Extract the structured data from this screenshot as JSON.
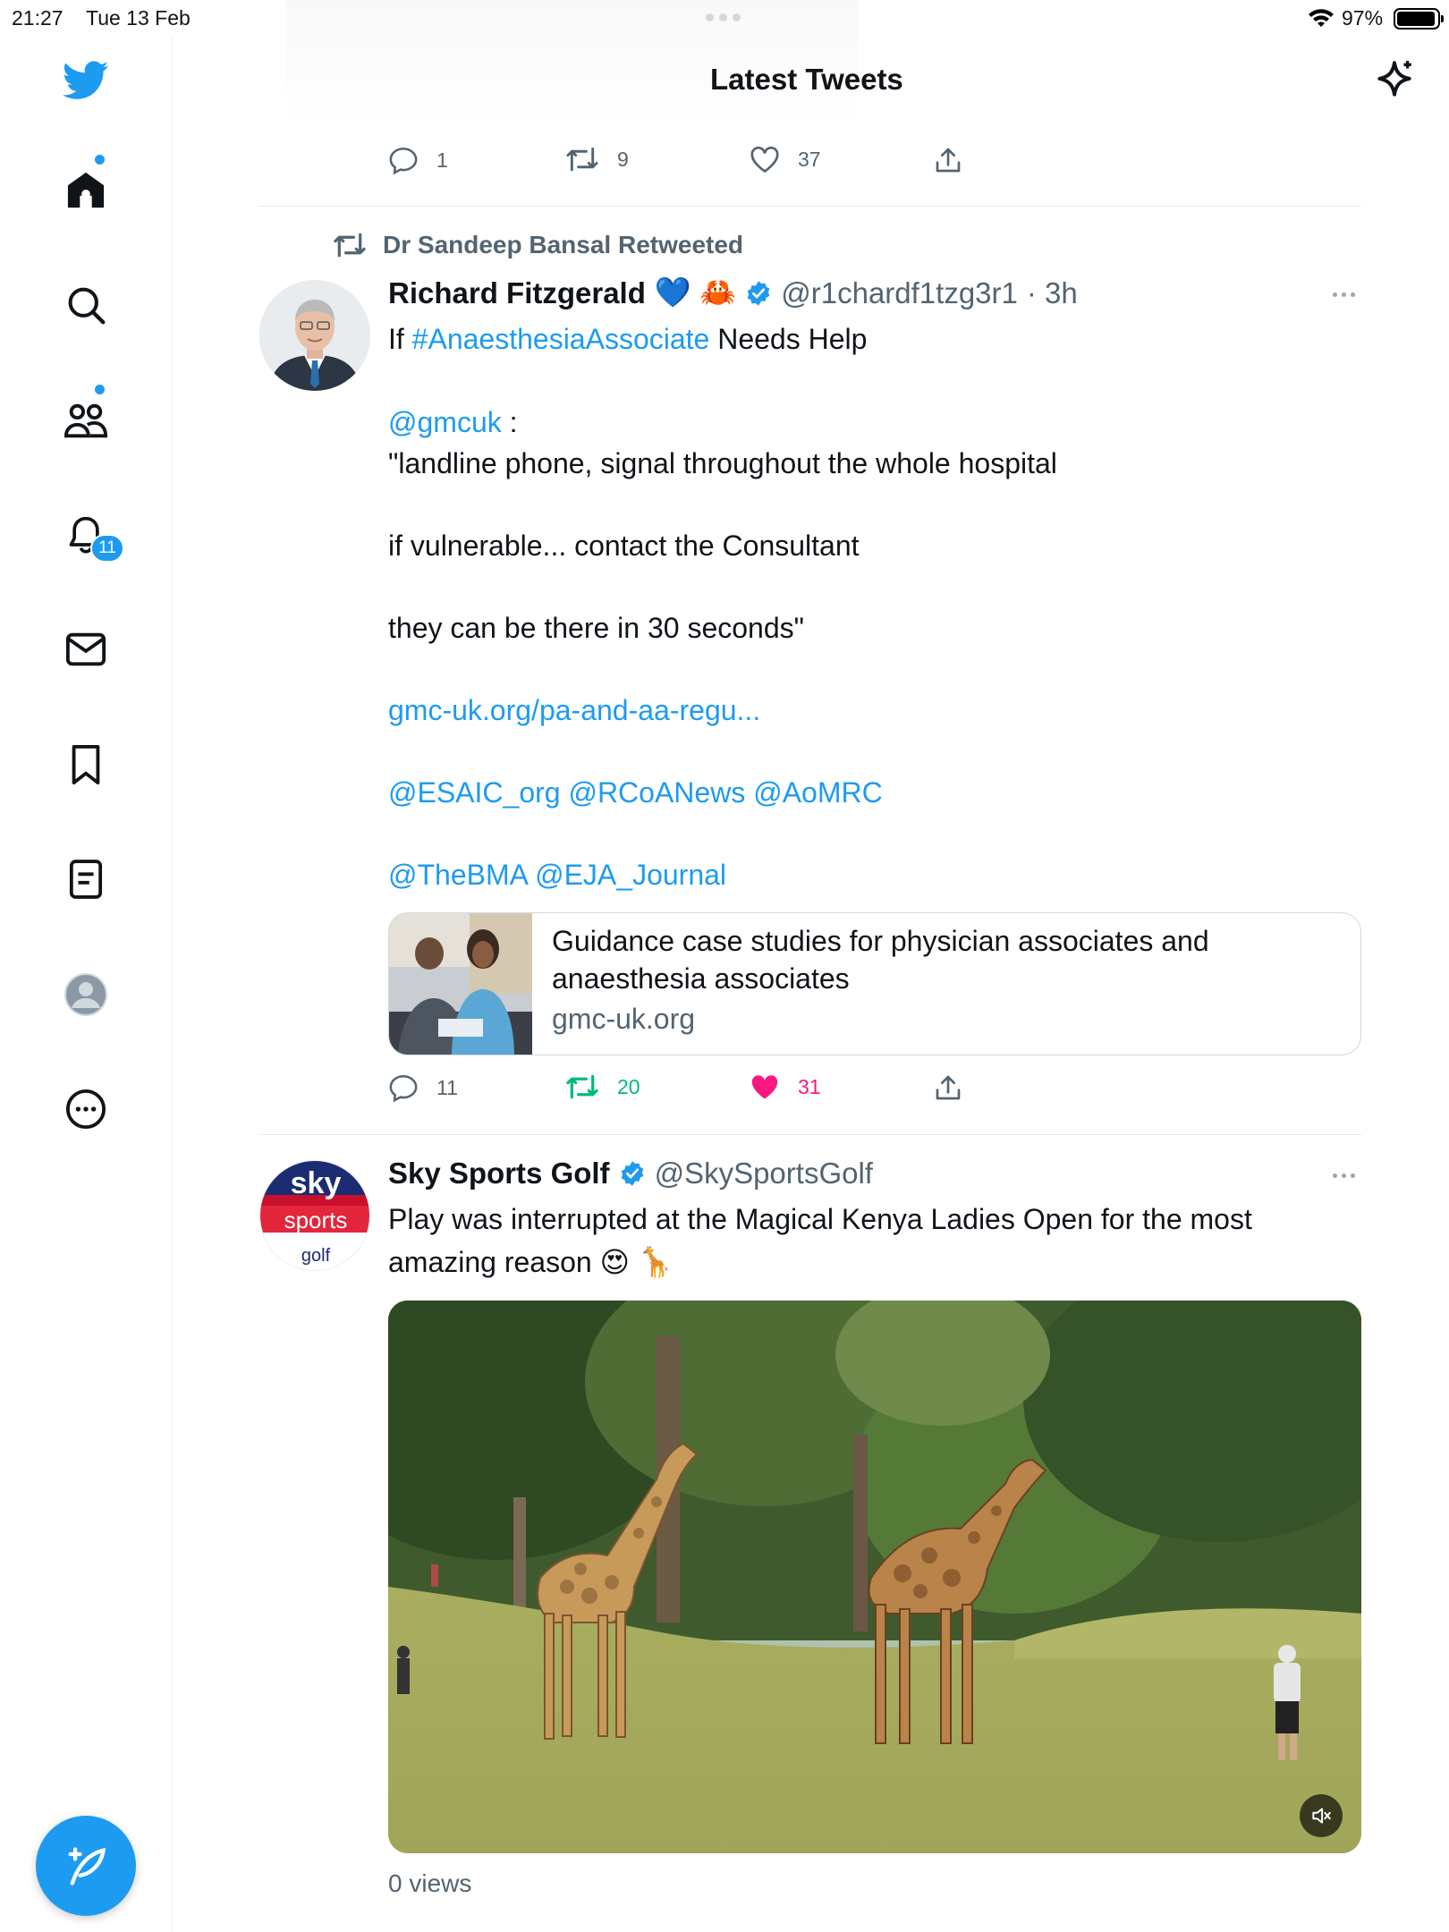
{
  "status_bar": {
    "time": "21:27",
    "date": "Tue 13 Feb",
    "battery_percent": "97%"
  },
  "header": {
    "title": "Latest Tweets"
  },
  "sidebar": {
    "notifications_badge": "11"
  },
  "prev_tweet": {
    "replies": "1",
    "retweets": "9",
    "likes": "37"
  },
  "tweet1": {
    "retweeted_by": "Dr Sandeep Bansal Retweeted",
    "author_name": "Richard Fitzgerald",
    "author_emojis": "💙 🦀",
    "handle": "@r1chardf1tzg3r1",
    "time": "· 3h",
    "line1_prefix": "If ",
    "line1_hashtag": "#AnaesthesiaAssociate",
    "line1_suffix": " Needs Help",
    "mention_gmc": "@gmcuk",
    "mention_gmc_suffix": " :",
    "quote_line1": "\"landline phone, signal throughout the whole hospital",
    "quote_line2": "if  vulnerable... contact the Consultant",
    "quote_line3": "they can be there in 30 seconds\"",
    "url": "gmc-uk.org/pa-and-aa-regu...",
    "mentions_line1": "@ESAIC_org @RCoANews @AoMRC",
    "mentions_line2": "@TheBMA @EJA_Journal",
    "card_title": "Guidance case studies for physician associates and anaesthesia associates",
    "card_domain": "gmc-uk.org",
    "replies": "11",
    "retweets": "20",
    "likes": "31"
  },
  "tweet2": {
    "author_name": "Sky Sports Golf",
    "handle": "@SkySportsGolf",
    "line1": "Play was interrupted at the Magical Kenya Ladies Open for the most",
    "line2": "amazing reason",
    "line2_emojis": "😍 🦒",
    "views": "0 views",
    "avatar_text_top": "sky",
    "avatar_text_mid": "sports",
    "avatar_text_bottom": "golf"
  },
  "colors": {
    "accent": "#1d9bf0",
    "like_active": "#f91880",
    "retweet_active": "#00ba7c",
    "muted": "#536471"
  }
}
